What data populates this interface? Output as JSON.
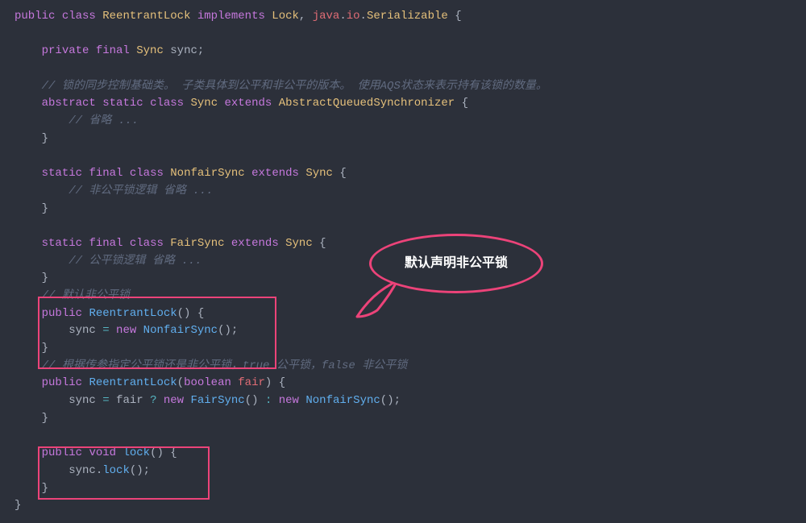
{
  "callout": {
    "text": "默认声明非公平锁"
  },
  "code": {
    "l1": {
      "public": "public",
      "class": "class",
      "ReentrantLock": "ReentrantLock",
      "implements": "implements",
      "Lock": "Lock",
      "java": "java",
      "io": "io",
      "Serializable": "Serializable"
    },
    "l3": {
      "private": "private",
      "final": "final",
      "Sync": "Sync",
      "sync": "sync"
    },
    "l5": {
      "cmt": "// 锁的同步控制基础类。 子类具体到公平和非公平的版本。 使用AQS状态来表示持有该锁的数量。"
    },
    "l6": {
      "abstract": "abstract",
      "static": "static",
      "class": "class",
      "Sync": "Sync",
      "extends": "extends",
      "AQS": "AbstractQueuedSynchronizer"
    },
    "l7": {
      "cmt": "// 省略 ..."
    },
    "l10": {
      "static": "static",
      "final": "final",
      "class": "class",
      "NonfairSync": "NonfairSync",
      "extends": "extends",
      "Sync": "Sync"
    },
    "l11": {
      "cmt": "// 非公平锁逻辑 省略 ..."
    },
    "l14": {
      "static": "static",
      "final": "final",
      "class": "class",
      "FairSync": "FairSync",
      "extends": "extends",
      "Sync": "Sync"
    },
    "l15": {
      "cmt": "// 公平锁逻辑 省略 ..."
    },
    "l17": {
      "cmt": "// 默认非公平锁"
    },
    "l18": {
      "public": "public",
      "ReentrantLock": "ReentrantLock"
    },
    "l19": {
      "sync": "sync",
      "new": "new",
      "NonfairSync": "NonfairSync"
    },
    "l21": {
      "cmt": "// 根据传参指定公平锁还是非公平锁，true 公平锁，false 非公平锁"
    },
    "l22": {
      "public": "public",
      "ReentrantLock": "ReentrantLock",
      "boolean": "boolean",
      "fair": "fair"
    },
    "l23": {
      "sync": "sync",
      "fair": "fair",
      "new1": "new",
      "FairSync": "FairSync",
      "new2": "new",
      "NonfairSync": "NonfairSync"
    },
    "l26": {
      "public": "public",
      "void": "void",
      "lock": "lock"
    },
    "l27": {
      "sync": "sync",
      "lock": "lock"
    }
  }
}
